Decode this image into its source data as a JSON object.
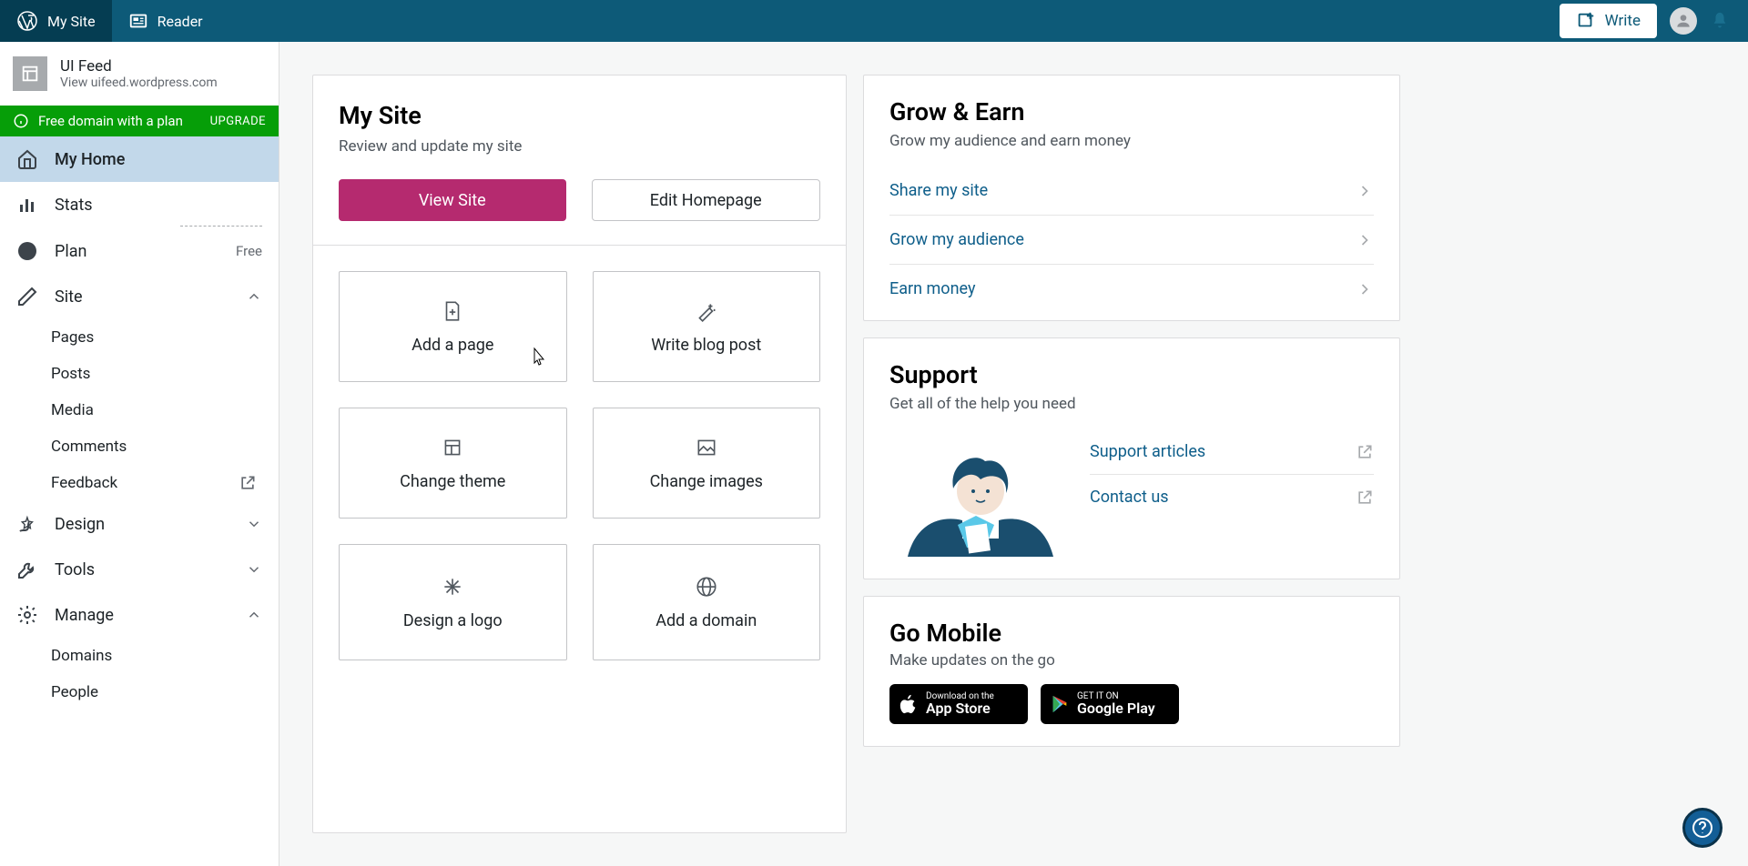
{
  "masterbar": {
    "my_site": "My Site",
    "reader": "Reader",
    "write": "Write"
  },
  "site": {
    "name": "UI Feed",
    "url": "View uifeed.wordpress.com"
  },
  "upgrade": {
    "text": "Free domain with a plan",
    "cta": "UPGRADE"
  },
  "nav": {
    "my_home": "My Home",
    "stats": "Stats",
    "plan": "Plan",
    "plan_badge": "Free",
    "site": "Site",
    "pages": "Pages",
    "posts": "Posts",
    "media": "Media",
    "comments": "Comments",
    "feedback": "Feedback",
    "design": "Design",
    "tools": "Tools",
    "manage": "Manage",
    "domains": "Domains",
    "people": "People"
  },
  "mysite": {
    "title": "My Site",
    "subtitle": "Review and update my site",
    "view_site": "View Site",
    "edit_homepage": "Edit Homepage",
    "tiles": {
      "add_page": "Add a page",
      "write_post": "Write blog post",
      "change_theme": "Change theme",
      "change_images": "Change images",
      "design_logo": "Design a logo",
      "add_domain": "Add a domain"
    }
  },
  "grow": {
    "title": "Grow & Earn",
    "subtitle": "Grow my audience and earn money",
    "share": "Share my site",
    "grow": "Grow my audience",
    "earn": "Earn money"
  },
  "support": {
    "title": "Support",
    "subtitle": "Get all of the help you need",
    "articles": "Support articles",
    "contact": "Contact us"
  },
  "mobile": {
    "title": "Go Mobile",
    "subtitle": "Make updates on the go",
    "appstore_small": "Download on the",
    "appstore_big": "App Store",
    "play_small": "GET IT ON",
    "play_big": "Google Play"
  }
}
